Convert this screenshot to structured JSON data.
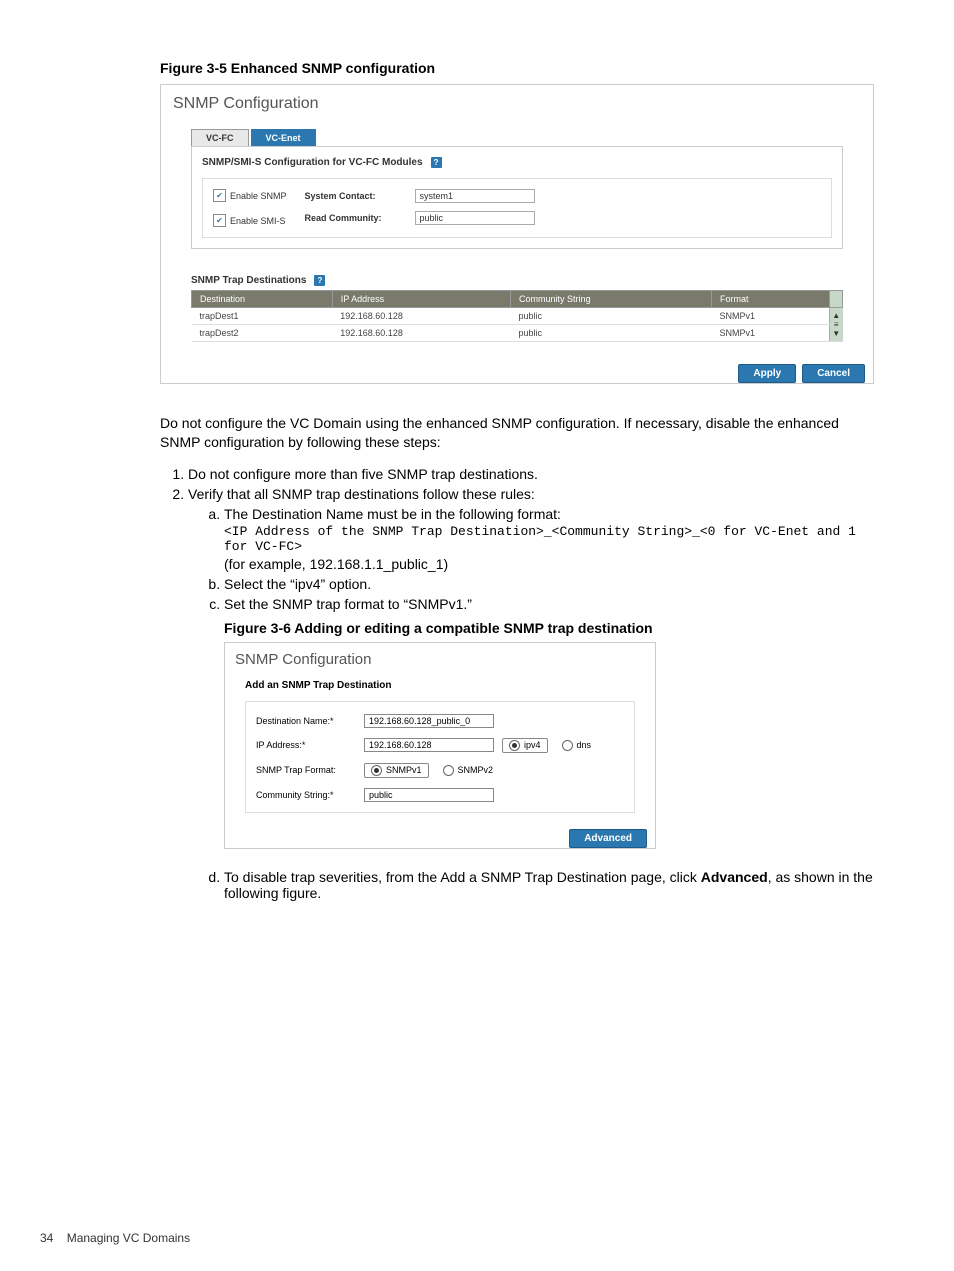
{
  "figure35": {
    "caption": "Figure 3-5 Enhanced SNMP configuration",
    "window_title": "SNMP Configuration",
    "tabs": {
      "vcfc": "VC-FC",
      "vcenet": "VC-Enet"
    },
    "panel_heading": "SNMP/SMI-S Configuration for VC-FC Modules",
    "checks": {
      "enable_snmp": "Enable SNMP",
      "enable_smis": "Enable SMI-S"
    },
    "fields": {
      "system_contact_label": "System Contact:",
      "system_contact_value": "system1",
      "read_community_label": "Read Community:",
      "read_community_value": "public"
    },
    "trap_heading": "SNMP Trap Destinations",
    "table": {
      "headers": {
        "dest": "Destination",
        "ip": "IP Address",
        "comm": "Community String",
        "fmt": "Format"
      },
      "rows": [
        {
          "dest": "trapDest1",
          "ip": "192.168.60.128",
          "comm": "public",
          "fmt": "SNMPv1"
        },
        {
          "dest": "trapDest2",
          "ip": "192.168.60.128",
          "comm": "public",
          "fmt": "SNMPv1"
        }
      ]
    },
    "buttons": {
      "apply": "Apply",
      "cancel": "Cancel"
    }
  },
  "text": {
    "intro": "Do not configure the VC Domain using the enhanced SNMP configuration. If necessary, disable the enhanced SNMP configuration by following these steps:",
    "step1": "Do not configure more than five SNMP trap destinations.",
    "step2": "Verify that all SNMP trap destinations follow these rules:",
    "step2a": "The Destination Name must be in the following format:",
    "step2a_code1": "<IP Address of the SNMP Trap Destination>_<Community String>_<0 for VC-Enet and 1 for VC-FC>",
    "step2a_example": "(for example, 192.168.1.1_public_1)",
    "step2b": "Select the “ipv4” option.",
    "step2c": "Set the SNMP trap format to “SNMPv1.”",
    "step2d_pre": "To disable trap severities, from the Add a SNMP Trap Destination page, click ",
    "step2d_bold": "Advanced",
    "step2d_post": ", as shown in the following figure."
  },
  "figure36": {
    "caption": "Figure 3-6 Adding or editing a compatible SNMP trap destination",
    "window_title": "SNMP Configuration",
    "heading": "Add an SNMP Trap Destination",
    "rows": {
      "dest_label": "Destination Name:*",
      "dest_value": "192.168.60.128_public_0",
      "ip_label": "IP Address:*",
      "ip_value": "192.168.60.128",
      "ip_radio1": "ipv4",
      "ip_radio2": "dns",
      "fmt_label": "SNMP Trap Format:",
      "fmt_radio1": "SNMPv1",
      "fmt_radio2": "SNMPv2",
      "comm_label": "Community String:*",
      "comm_value": "public"
    },
    "button": "Advanced"
  },
  "footer": {
    "page": "34",
    "section": "Managing VC Domains"
  }
}
